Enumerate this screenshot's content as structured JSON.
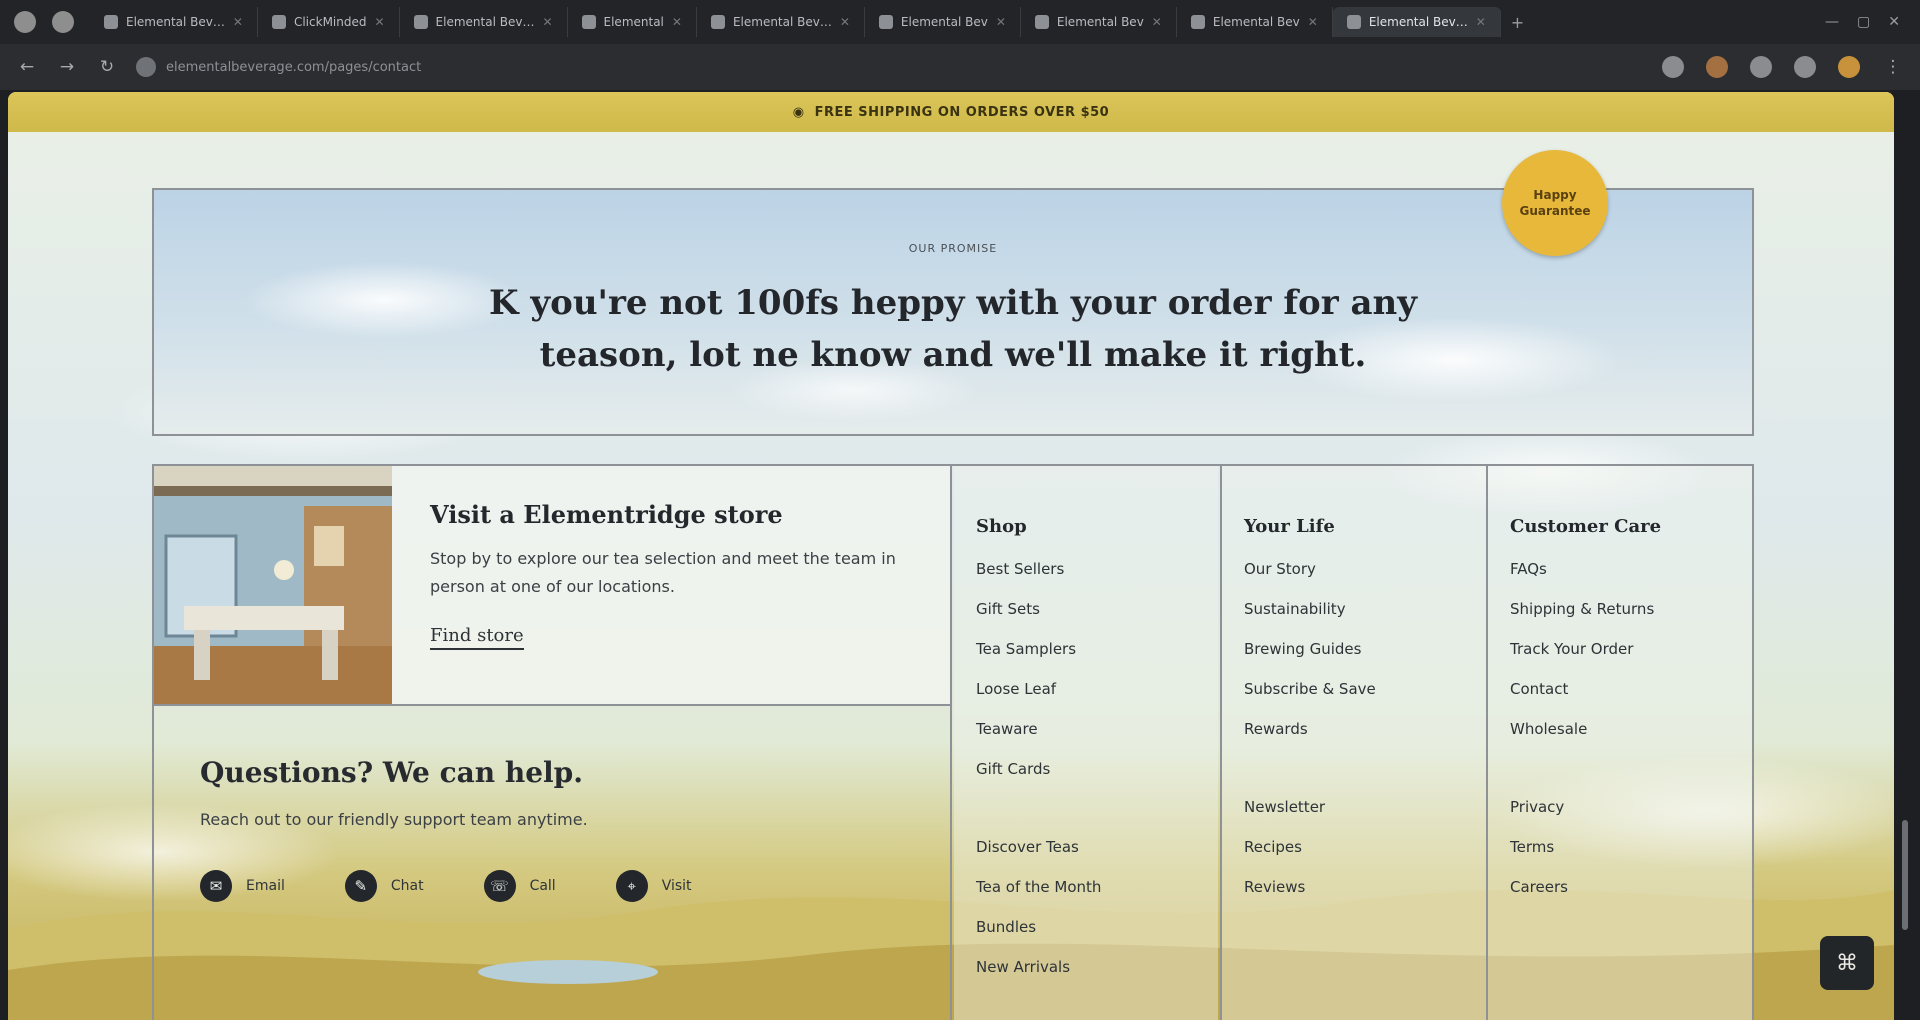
{
  "browser": {
    "tabs": [
      {
        "label": "Elemental Bev…"
      },
      {
        "label": "ClickMinded"
      },
      {
        "label": "Elemental Bev…"
      },
      {
        "label": "Elemental"
      },
      {
        "label": "Elemental Bev…"
      },
      {
        "label": "Elemental Bev"
      },
      {
        "label": "Elemental Bev"
      },
      {
        "label": "Elemental Bev"
      },
      {
        "label": "Elemental Bev…",
        "active": true
      }
    ],
    "new_tab": "+",
    "address": "elementalbeverage.com/pages/contact",
    "window_controls": [
      "—",
      "▢",
      "✕"
    ]
  },
  "page": {
    "announcement": "FREE SHIPPING ON ORDERS OVER $50",
    "hero": {
      "eyebrow": "OUR PROMISE",
      "title": "K you're not 100fs heppy with your order for any teason, lot ne know and we'll make it right.",
      "badge": "Happy Guarantee"
    },
    "feature": {
      "title": "Visit a Elementridge store",
      "description": "Stop by to explore our tea selection and meet the team in person at one of our locations.",
      "link": "Find store"
    },
    "help": {
      "title": "Questions? We can help.",
      "subtitle": "Reach out to our friendly support team anytime.",
      "items": [
        {
          "label": "Email",
          "icon": "envelope-icon",
          "glyph": "✉"
        },
        {
          "label": "Chat",
          "icon": "chat-icon",
          "glyph": "✎"
        },
        {
          "label": "Call",
          "icon": "phone-icon",
          "glyph": "☏"
        },
        {
          "label": "Visit",
          "icon": "pin-icon",
          "glyph": "⌖"
        }
      ]
    },
    "columns": [
      {
        "heading": "Shop",
        "groups": [
          [
            "Best Sellers",
            "Gift Sets",
            "Tea Samplers",
            "Loose Leaf",
            "Teaware",
            "Gift Cards"
          ],
          [
            "Discover Teas",
            "Tea of the Month",
            "Bundles",
            "New Arrivals"
          ]
        ]
      },
      {
        "heading": "Your Life",
        "groups": [
          [
            "Our Story",
            "Sustainability",
            "Brewing Guides",
            "Subscribe & Save",
            "Rewards"
          ],
          [
            "Newsletter",
            "Recipes",
            "Reviews"
          ]
        ]
      },
      {
        "heading": "Customer Care",
        "groups": [
          [
            "FAQs",
            "Shipping & Returns",
            "Track Your Order",
            "Contact",
            "Wholesale"
          ],
          [
            "Privacy",
            "Terms",
            "Careers"
          ]
        ]
      }
    ],
    "chat_button": "⌘"
  }
}
